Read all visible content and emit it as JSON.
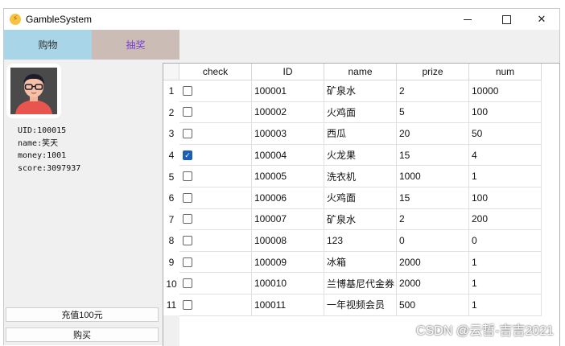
{
  "window": {
    "title": "GambleSystem",
    "controls": {
      "minimize_icon": "minimize-icon",
      "maximize_icon": "maximize-icon",
      "close_icon": "close-icon"
    }
  },
  "tabs": [
    {
      "label": "购物",
      "color": "#a8d5e8"
    },
    {
      "label": "抽奖",
      "color": "#cbbdb6"
    }
  ],
  "user": {
    "avatar_icon": "avatar-icon",
    "uid": "UID:100015",
    "name": "name:笑天",
    "money": "money:1001",
    "score": "score:3097937"
  },
  "buttons": {
    "recharge": "充值100元",
    "buy": "购买"
  },
  "table": {
    "columns": [
      "check",
      "ID",
      "name",
      "prize",
      "num"
    ],
    "rows": [
      {
        "n": "1",
        "checked": false,
        "id": "100001",
        "name": "矿泉水",
        "prize": "2",
        "num": "10000"
      },
      {
        "n": "2",
        "checked": false,
        "id": "100002",
        "name": "火鸡面",
        "prize": "5",
        "num": "100"
      },
      {
        "n": "3",
        "checked": false,
        "id": "100003",
        "name": "西瓜",
        "prize": "20",
        "num": "50"
      },
      {
        "n": "4",
        "checked": true,
        "id": "100004",
        "name": "火龙果",
        "prize": "15",
        "num": "4"
      },
      {
        "n": "5",
        "checked": false,
        "id": "100005",
        "name": "洗衣机",
        "prize": "1000",
        "num": "1"
      },
      {
        "n": "6",
        "checked": false,
        "id": "100006",
        "name": "火鸡面",
        "prize": "15",
        "num": "100"
      },
      {
        "n": "7",
        "checked": false,
        "id": "100007",
        "name": "矿泉水",
        "prize": "2",
        "num": "200"
      },
      {
        "n": "8",
        "checked": false,
        "id": "100008",
        "name": "123",
        "prize": "0",
        "num": "0"
      },
      {
        "n": "9",
        "checked": false,
        "id": "100009",
        "name": "冰箱",
        "prize": "2000",
        "num": "1"
      },
      {
        "n": "10",
        "checked": false,
        "id": "100010",
        "name": "兰博基尼代金券",
        "prize": "2000",
        "num": "1"
      },
      {
        "n": "11",
        "checked": false,
        "id": "100011",
        "name": "一年视频会员",
        "prize": "500",
        "num": "1"
      }
    ]
  },
  "watermark": "CSDN @云哲-吉吉2021"
}
